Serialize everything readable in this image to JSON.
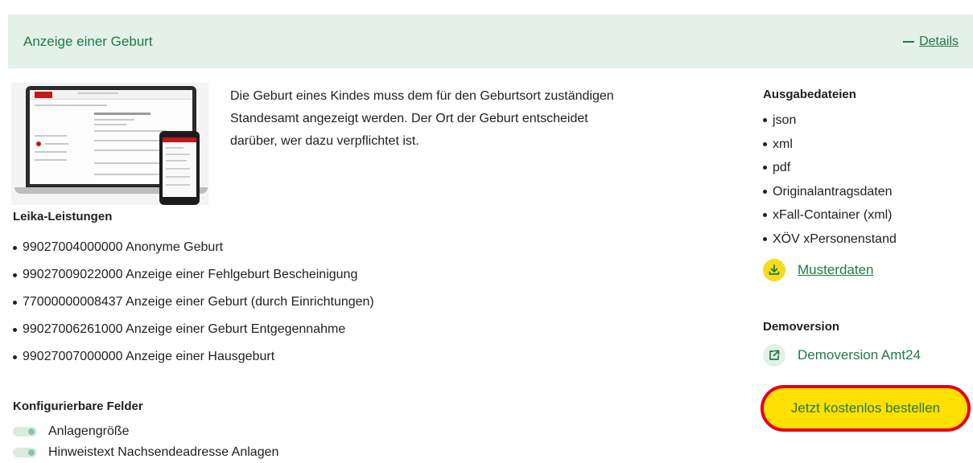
{
  "header": {
    "title": "Anzeige einer Geburt",
    "details_label": "Details"
  },
  "description": "Die Geburt eines Kindes muss dem für den Geburtsort zuständigen Standesamt angezeigt werden. Der Ort der Geburt entscheidet darüber, wer dazu verpflichtet ist.",
  "leika": {
    "heading": "Leika-Leistungen",
    "items": [
      "99027004000000 Anonyme Geburt",
      "99027009022000 Anzeige einer Fehlgeburt Bescheinigung",
      "77000000008437 Anzeige einer Geburt (durch Einrichtungen)",
      "99027006261000 Anzeige einer Geburt Entgegennahme",
      "99027007000000 Anzeige einer Hausgeburt"
    ]
  },
  "fields": {
    "heading": "Konfigurierbare Felder",
    "items": [
      "Anlagengröße",
      "Hinweistext Nachsendeadresse Anlagen"
    ]
  },
  "outputs": {
    "heading": "Ausgabedateien",
    "items": [
      "json",
      "xml",
      "pdf",
      "Originalantragsdaten",
      "xFall-Container (xml)",
      "XÖV xPersonenstand"
    ],
    "sample_label": "Musterdaten"
  },
  "demo": {
    "heading": "Demoversion",
    "link_label": "Demoversion Amt24"
  },
  "order_button": "Jetzt kostenlos bestellen",
  "colors": {
    "accent_green": "#1f7a45",
    "header_bg": "#e3f1e8",
    "button_yellow": "#ffe000",
    "highlight_red": "#e3001b"
  }
}
